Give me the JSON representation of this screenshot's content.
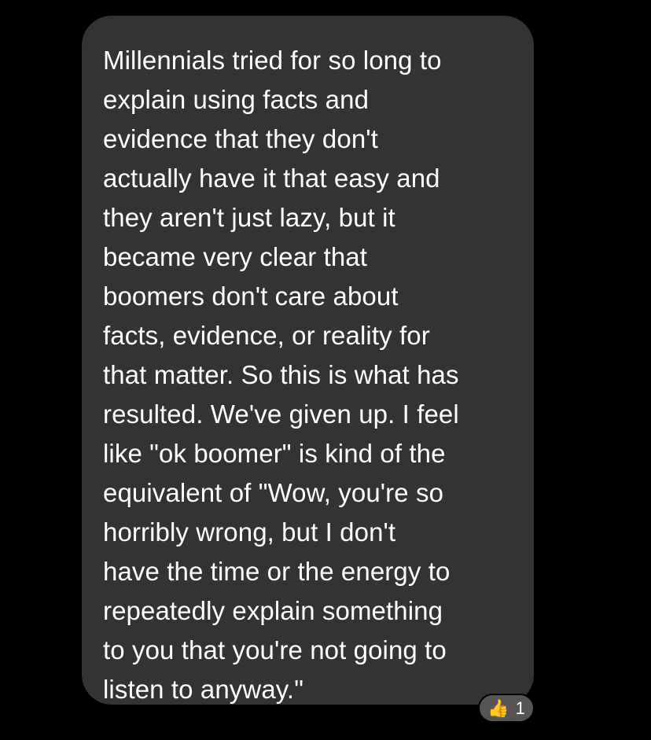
{
  "message": {
    "lines": [
      "Millennials tried for so long to",
      "explain using facts and",
      "evidence that they don't",
      "actually have it that easy and",
      "they aren't just lazy, but it",
      "became very clear that",
      "boomers don't care about",
      "facts, evidence, or reality for",
      "that matter. So this is what has",
      "resulted. We've given up. I feel",
      "like \"ok boomer\" is kind of the",
      "equivalent of \"Wow, you're so",
      "horribly wrong, but I don't",
      "have the time or the energy to",
      "repeatedly explain something",
      "to you that you're not going to",
      "listen to anyway.\""
    ]
  },
  "reaction": {
    "icon": "thumbs-up-icon",
    "emoji": "👍",
    "count": "1"
  },
  "colors": {
    "background": "#000000",
    "bubble": "#333333",
    "text": "#ffffff",
    "reaction_bg": "#555555"
  }
}
